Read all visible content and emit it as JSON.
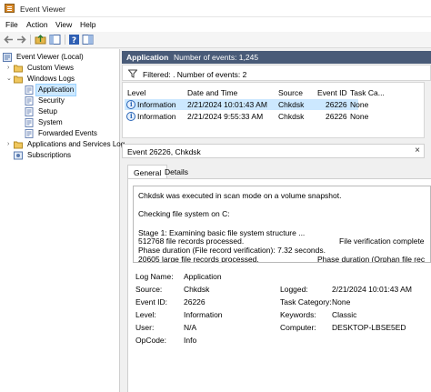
{
  "window": {
    "title": "Event Viewer"
  },
  "menu": {
    "items": [
      "File",
      "Action",
      "View",
      "Help"
    ]
  },
  "tree": {
    "root": "Event Viewer (Local)",
    "custom_views": "Custom Views",
    "windows_logs": "Windows Logs",
    "application": "Application",
    "security": "Security",
    "setup": "Setup",
    "system": "System",
    "forwarded_events": "Forwarded Events",
    "apps_services": "Applications and Services Log",
    "subscriptions": "Subscriptions"
  },
  "log_header": {
    "name": "Application",
    "count_text": "Number of events: 1,245"
  },
  "filter": {
    "text": "Filtered: . Number of events: 2"
  },
  "columns": [
    "Level",
    "Date and Time",
    "Source",
    "Event ID",
    "Task Ca..."
  ],
  "rows": [
    {
      "level": "Information",
      "date": "2/21/2024 10:01:43 AM",
      "source": "Chkdsk",
      "event_id": "26226",
      "task": "None"
    },
    {
      "level": "Information",
      "date": "2/21/2024 9:55:33 AM",
      "source": "Chkdsk",
      "event_id": "26226",
      "task": "None"
    }
  ],
  "detail": {
    "title": "Event 26226, Chkdsk",
    "close": "×",
    "tabs": [
      "General",
      "Details"
    ],
    "desc_lines": [
      "Chkdsk was executed in scan mode on a volume snapshot.",
      "Checking file system on C:",
      "Stage 1: Examining basic file system structure ...",
      "  512768 file records processed.",
      "  Phase duration (File record verification): 7.32 seconds.",
      "  20605 large file records processed."
    ],
    "desc_right": [
      "File verification complete",
      "Phase duration (Orphan file rec"
    ],
    "props_left": {
      "log_name_label": "Log Name:",
      "log_name": "Application",
      "source_label": "Source:",
      "source": "Chkdsk",
      "event_id_label": "Event ID:",
      "event_id": "26226",
      "level_label": "Level:",
      "level": "Information",
      "user_label": "User:",
      "user": "N/A",
      "opcode_label": "OpCode:",
      "opcode": "Info"
    },
    "props_right": {
      "logged_label": "Logged:",
      "logged": "2/21/2024 10:01:43 AM",
      "task_label": "Task Category:",
      "task": "None",
      "keywords_label": "Keywords:",
      "keywords": "Classic",
      "computer_label": "Computer:",
      "computer": "DESKTOP-LBSE5ED"
    }
  },
  "colors": {
    "header_bg": "#495b78",
    "selection": "#cce8ff",
    "accent": "#2a66b8"
  }
}
